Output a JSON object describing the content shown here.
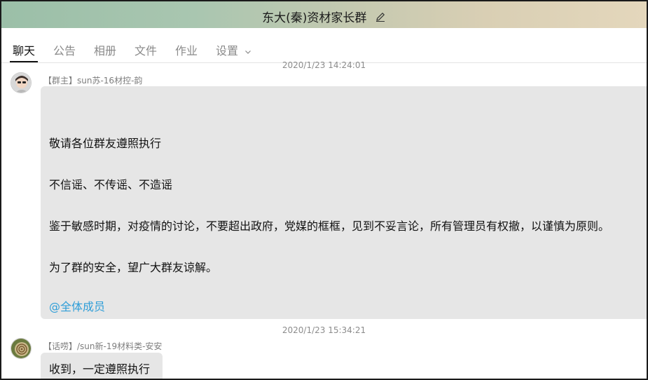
{
  "window": {
    "title": "东大(秦)资材家长群"
  },
  "tabs": [
    {
      "label": "聊天",
      "active": true
    },
    {
      "label": "公告",
      "active": false
    },
    {
      "label": "相册",
      "active": false
    },
    {
      "label": "文件",
      "active": false
    },
    {
      "label": "作业",
      "active": false
    },
    {
      "label": "设置",
      "active": false,
      "has_dropdown": true
    }
  ],
  "messages": [
    {
      "timestamp": "2020/1/23 14:24:01",
      "sender": "【群主】sun苏-16材控-韵",
      "lines": [
        "敬请各位群友遵照执行",
        "不信谣、不传谣、不造谣",
        "鉴于敏感时期，对疫情的讨论，不要超出政府，党媒的框框，见到不妥言论，所有管理员有权撤，以谨慎为原则。",
        "为了群的安全，望广大群友谅解。"
      ],
      "mention": "@全体成员"
    },
    {
      "timestamp": "2020/1/23 15:34:21",
      "sender": "【话唠】/sun新-19材料类-安安",
      "lines": [
        "收到，一定遵照执行"
      ]
    }
  ],
  "colors": {
    "bubble": "#e6e6e6",
    "mention": "#2f9ed8",
    "titlebar_start": "#9bbfa8",
    "titlebar_end": "#e4d7bc"
  }
}
